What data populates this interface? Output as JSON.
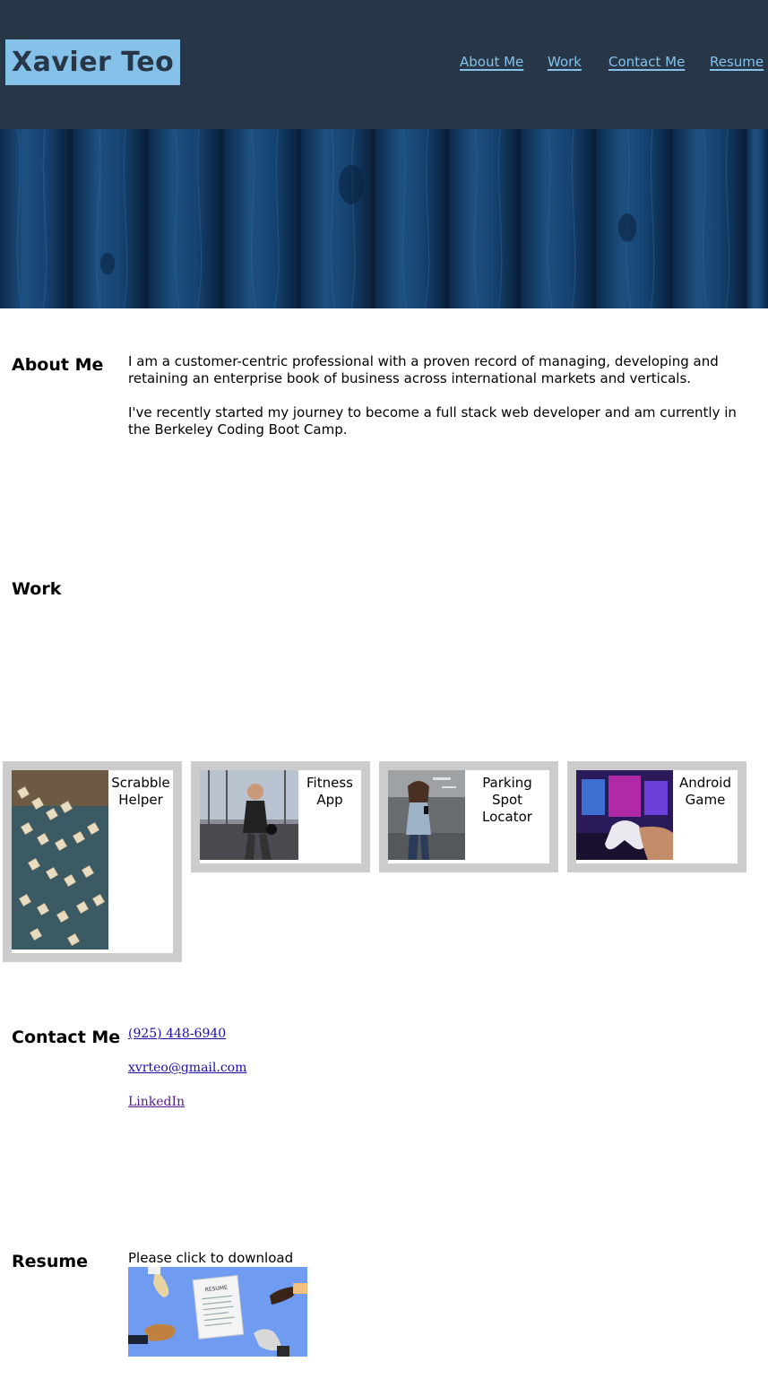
{
  "header": {
    "name": "Xavier Teo",
    "nav": [
      "About Me",
      "Work",
      "Contact Me",
      "Resume"
    ]
  },
  "about": {
    "title": "About Me",
    "paragraphs": [
      "I am a customer-centric professional with a proven record of managing, developing and retaining an enterprise book of business across international markets and verticals.",
      "I've recently started my journey to become a full stack web developer and am currently in the Berkeley Coding Boot Camp."
    ]
  },
  "work": {
    "title": "Work",
    "projects": [
      {
        "label": "Scrabble Helper",
        "image": "scrabble-board-image"
      },
      {
        "label": "Fitness App",
        "image": "fitness-woman-image"
      },
      {
        "label": "Parking Spot Locator",
        "image": "woman-with-phone-in-garage-image"
      },
      {
        "label": "Android Game",
        "image": "game-controller-image"
      }
    ]
  },
  "contact": {
    "title": "Contact Me",
    "phone": "(925) 448-6940",
    "email": "xvrteo@gmail.com",
    "linkedin": "LinkedIn"
  },
  "resume": {
    "title": "Resume",
    "instruction": "Please click to download",
    "image_text": "RESUME"
  },
  "colors": {
    "header_bg": "#283747",
    "accent": "#85c1e9",
    "card_border": "#cccccc",
    "link": "#1a0dab",
    "visited_link": "#551a8b"
  }
}
